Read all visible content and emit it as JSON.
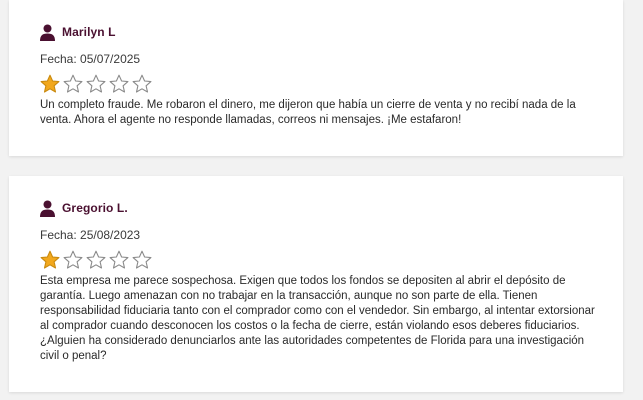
{
  "colors": {
    "author_name": "#4a1030",
    "icon": "#4a1030",
    "star_fill": "#f2a81d",
    "star_outline": "#8a8a8a",
    "background": "#f2f2f2",
    "card": "#ffffff"
  },
  "reviews": [
    {
      "author": "Marilyn L",
      "date_label": "Fecha:",
      "date": "05/07/2025",
      "rating": 1,
      "rating_max": 5,
      "text": "Un completo fraude. Me robaron el dinero, me dijeron que había un cierre de venta y no recibí nada de la venta. Ahora el agente no responde llamadas, correos ni mensajes. ¡Me estafaron!"
    },
    {
      "author": "Gregorio L.",
      "date_label": "Fecha:",
      "date": "25/08/2023",
      "rating": 1,
      "rating_max": 5,
      "text": "Esta empresa me parece sospechosa. Exigen que todos los fondos se depositen al abrir el depósito de garantía. Luego amenazan con no trabajar en la transacción, aunque no son parte de ella. Tienen responsabilidad fiduciaria tanto con el comprador como con el vendedor. Sin embargo, al intentar extorsionar al comprador cuando desconocen los costos o la fecha de cierre, están violando esos deberes fiduciarios. ¿Alguien ha considerado denunciarlos ante las autoridades competentes de Florida para una investigación civil o penal?"
    }
  ]
}
